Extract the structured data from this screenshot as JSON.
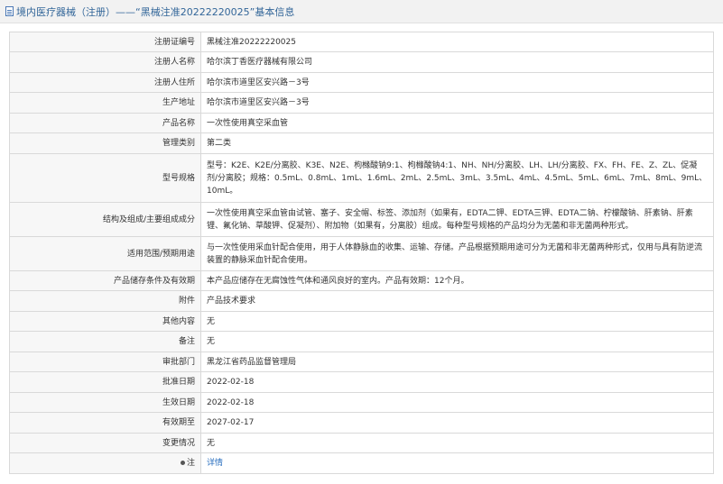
{
  "header": {
    "icon": "document-icon",
    "title": "境内医疗器械（注册）——“黑械注准20222220025”基本信息"
  },
  "rows": [
    {
      "label": "注册证编号",
      "value": "黑械注准20222220025"
    },
    {
      "label": "注册人名称",
      "value": "哈尔滨丁香医疗器械有限公司"
    },
    {
      "label": "注册人住所",
      "value": "哈尔滨市道里区安兴路－3号"
    },
    {
      "label": "生产地址",
      "value": "哈尔滨市道里区安兴路－3号"
    },
    {
      "label": "产品名称",
      "value": "一次性使用真空采血管"
    },
    {
      "label": "管理类别",
      "value": "第二类"
    },
    {
      "label": "型号规格",
      "value": "型号：K2E、K2E/分离胶、K3E、N2E、枸橼酸钠9:1、枸橼酸钠4:1、NH、NH/分离胶、LH、LH/分离胶、FX、FH、FE、Z、ZL、促凝剂/分离胶；规格：0.5mL、0.8mL、1mL、1.6mL、2mL、2.5mL、3mL、3.5mL、4mL、4.5mL、5mL、6mL、7mL、8mL、9mL、10mL。"
    },
    {
      "label": "结构及组成/主要组成成分",
      "value": "一次性使用真空采血管由试管、塞子、安全帽、标签、添加剂（如果有，EDTA二钾、EDTA三钾、EDTA二钠、柠檬酸钠、肝素钠、肝素锂、氟化钠、草酸钾、促凝剂）、附加物（如果有，分离胶）组成。每种型号规格的产品均分为无菌和非无菌两种形式。"
    },
    {
      "label": "适用范围/预期用途",
      "value": "与一次性使用采血针配合使用，用于人体静脉血的收集、运输、存储。产品根据预期用途可分为无菌和非无菌两种形式，仅用与具有防逆流装置的静脉采血针配合使用。"
    },
    {
      "label": "产品储存条件及有效期",
      "value": "本产品应储存在无腐蚀性气体和通风良好的室内。产品有效期：12个月。"
    },
    {
      "label": "附件",
      "value": "产品技术要求"
    },
    {
      "label": "其他内容",
      "value": "无"
    },
    {
      "label": "备注",
      "value": "无"
    },
    {
      "label": "审批部门",
      "value": "黑龙江省药品监督管理局"
    },
    {
      "label": "批准日期",
      "value": "2022-02-18"
    },
    {
      "label": "生效日期",
      "value": "2022-02-18"
    },
    {
      "label": "有效期至",
      "value": "2027-02-17"
    },
    {
      "label": "变更情况",
      "value": "无"
    },
    {
      "label": "注",
      "value": "详情",
      "label_icon": "dot-icon",
      "value_is_link": true
    }
  ],
  "colors": {
    "title": "#336699",
    "link": "#2a6fbf",
    "label_bg": "#f7f7f7",
    "border": "#d9d9d9",
    "titlebar_bg": "#f2f2f2"
  }
}
